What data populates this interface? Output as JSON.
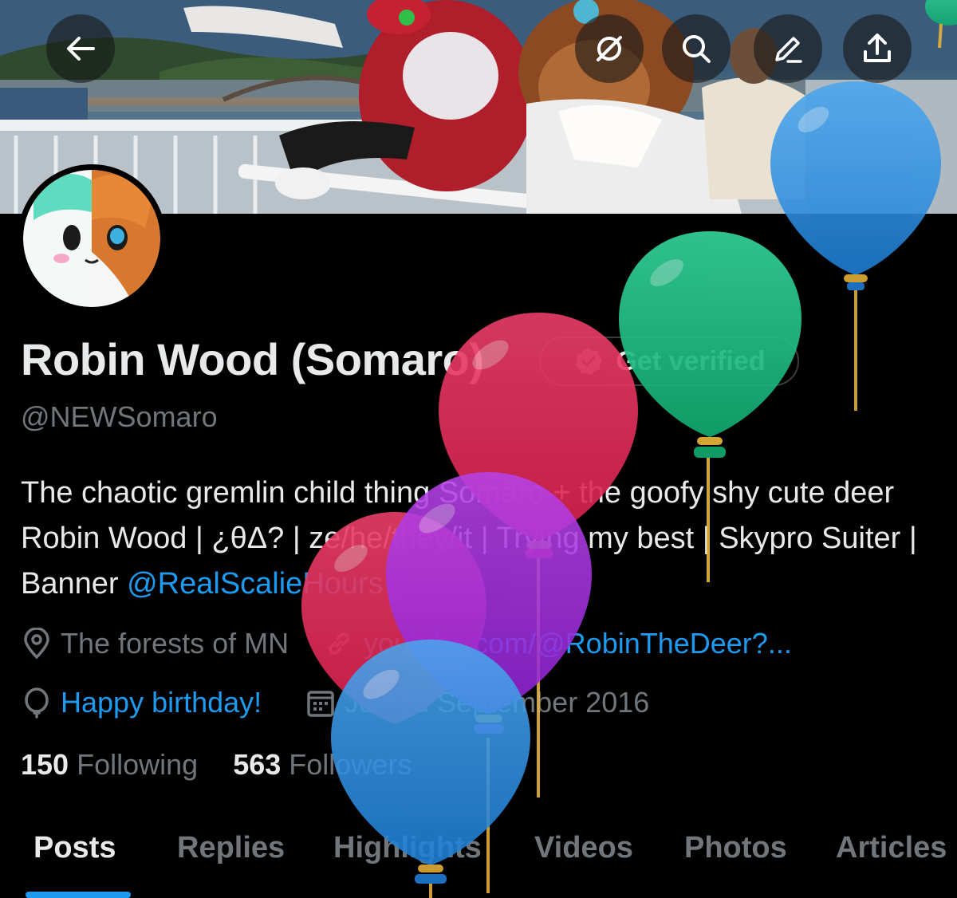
{
  "banner": {
    "back_icon": "arrow-left-icon",
    "actions": [
      "no-sync-icon",
      "search-icon",
      "edit-icon",
      "share-icon"
    ]
  },
  "profile": {
    "name": "Robin Wood (Somaro)",
    "verify_label": "Get verified",
    "handle": "@NEWSomaro",
    "bio_text": "The chaotic gremlin child thing Somaro + the goofy shy cute deer Robin Wood | ¿θΔ? | ze/he/they/it | Trying my best | Skypro Suiter | Banner ",
    "bio_mention": "@RealScalieHours",
    "location": "The forests of MN",
    "website": "youtube.com/@RobinTheDeer?...",
    "birthday": "Happy birthday!",
    "joined": "Joined September 2016",
    "following_count": "150",
    "following_label": "Following",
    "followers_count": "563",
    "followers_label": "Followers"
  },
  "tabs": [
    {
      "label": "Posts",
      "active": true
    },
    {
      "label": "Replies"
    },
    {
      "label": "Highlights"
    },
    {
      "label": "Videos"
    },
    {
      "label": "Photos"
    },
    {
      "label": "Articles"
    }
  ],
  "colors": {
    "accent": "#1d9bf0",
    "background": "#000000",
    "text_primary": "#e7e9ea",
    "text_secondary": "#71767b"
  }
}
